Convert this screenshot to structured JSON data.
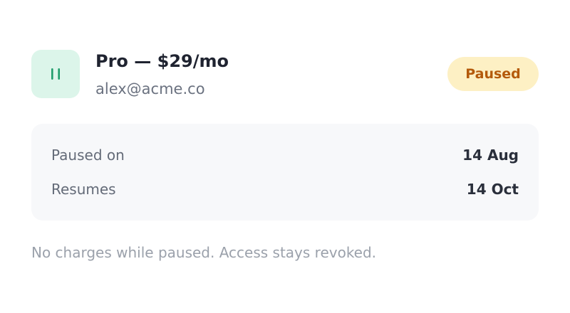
{
  "subscription": {
    "plan_name": "Pro — $29/mo",
    "email": "alex@acme.co",
    "status": "Paused",
    "icon": "pause-icon"
  },
  "details": {
    "rows": [
      {
        "label": "Paused on",
        "value": "14 Aug"
      },
      {
        "label": "Resumes",
        "value": "14 Oct"
      }
    ]
  },
  "note": "No charges while paused. Access stays revoked.",
  "colors": {
    "icon_bg": "#dcf5ea",
    "icon_fg": "#1f9d6b",
    "badge_bg": "#fdf0c4",
    "badge_fg": "#b45a0b"
  }
}
